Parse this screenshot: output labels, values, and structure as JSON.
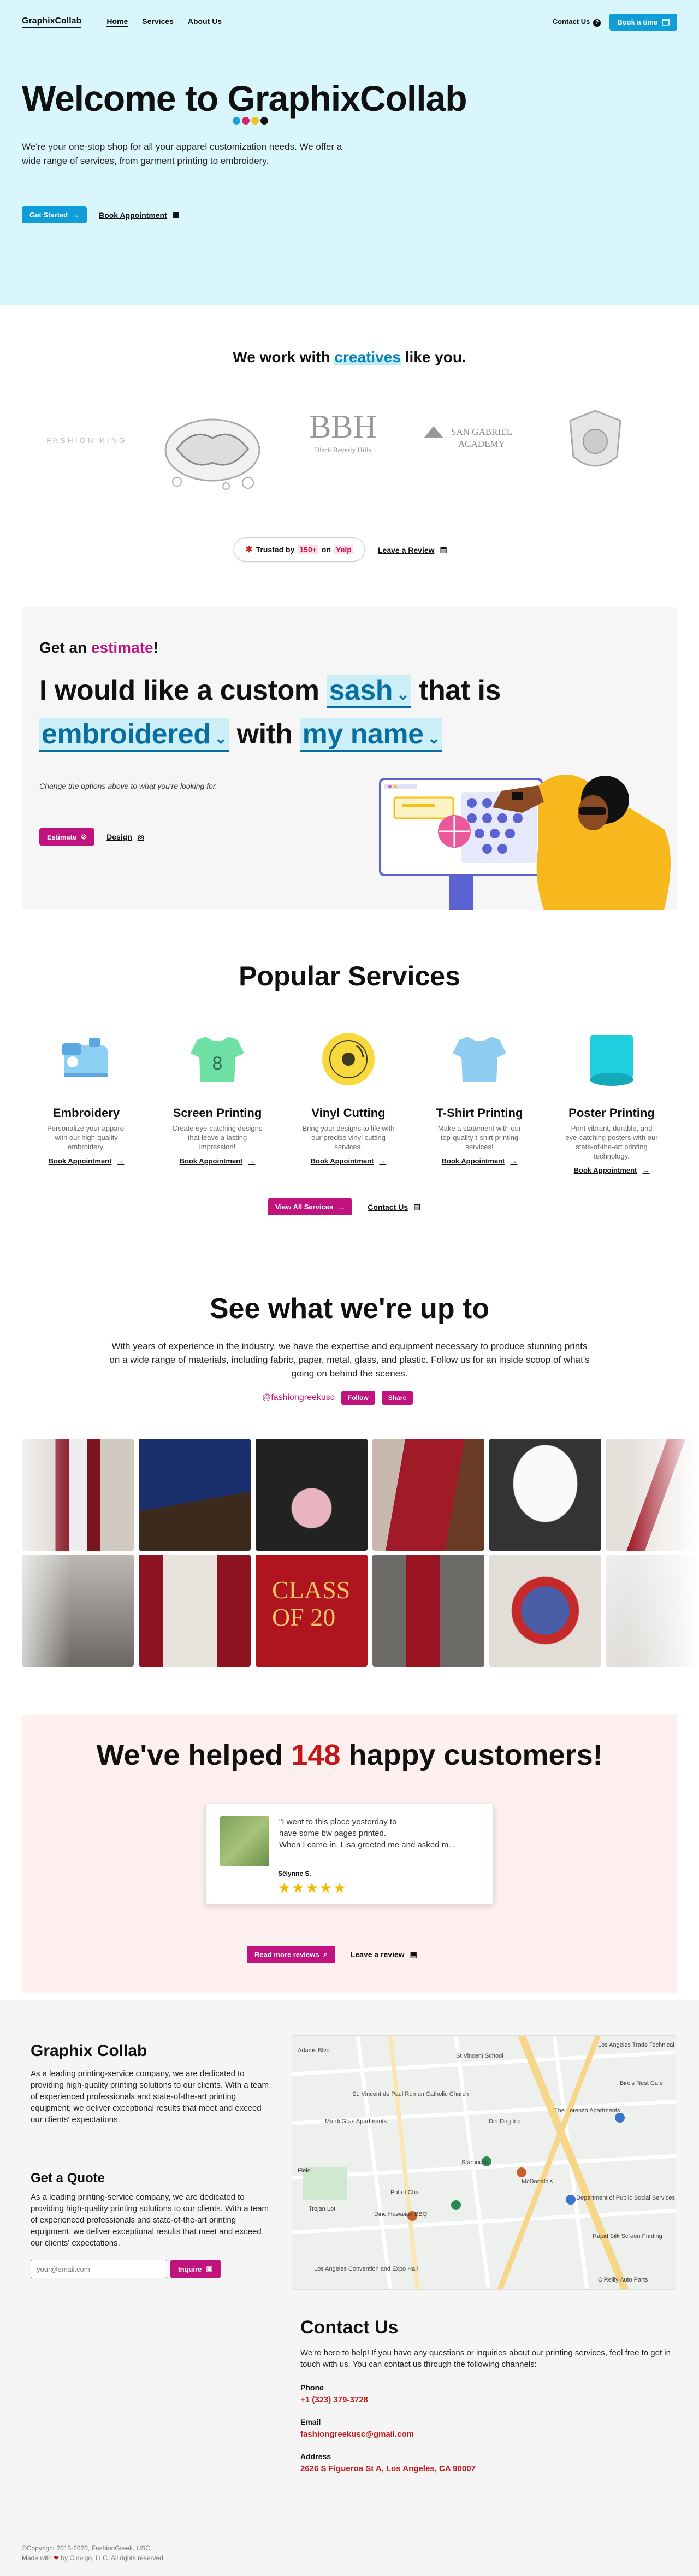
{
  "nav": {
    "logo": "GraphixCollab",
    "links": [
      "Home",
      "Services",
      "About Us"
    ],
    "contact": "Contact Us",
    "book": "Book a time"
  },
  "hero": {
    "title_prefix": "Welcome to ",
    "title_brand": "GraphixCollab",
    "lead": "We're your one-stop shop for all your apparel customization needs. We offer a wide range of services, from garment printing to embroidery.",
    "get_started": "Get Started",
    "book_appointment": "Book Appointment",
    "dot_colors": [
      "#1aa3d9",
      "#d6246e",
      "#f3c21b",
      "#111111"
    ]
  },
  "clients": {
    "title_pre": "We work with ",
    "title_hl": "creatives",
    "title_post": " like you.",
    "logos": [
      "FASHION KING",
      "Black Beverly Hills",
      "SAN GABRIEL ACADEMY"
    ],
    "trusted_pre": "Trusted by ",
    "trusted_num": "150+",
    "trusted_mid": " on ",
    "trusted_brand": "Yelp",
    "leave_review": "Leave a Review"
  },
  "estimate": {
    "get_an": "Get an ",
    "estimate_word": "estimate",
    "excl": "!",
    "s1": "I would like a custom ",
    "opt_item": "sash",
    "s2": " that is",
    "opt_method": "embroidered",
    "s3": " with ",
    "opt_content": "my name",
    "hint": "Change the options above to what you're looking for.",
    "btn_estimate": "Estimate",
    "btn_design": "Design"
  },
  "services": {
    "title": "Popular Services",
    "items": [
      {
        "name": "Embroidery",
        "desc": "Personalize your apparel with our high-quality embroidery.",
        "book": "Book Appointment"
      },
      {
        "name": "Screen Printing",
        "desc": "Create eye-catching designs that leave a lasting impression!",
        "book": "Book Appointment"
      },
      {
        "name": "Vinyl Cutting",
        "desc": "Bring your designs to life with our precise vinyl cutting services.",
        "book": "Book Appointment"
      },
      {
        "name": "T-Shirt Printing",
        "desc": "Make a statement with our top-quality t-shirt printing services!",
        "book": "Book Appointment"
      },
      {
        "name": "Poster Printing",
        "desc": "Print vibrant, durable, and eye-catching posters with our state-of-the-art printing technology.",
        "book": "Book Appointment"
      }
    ],
    "view_all": "View All Services",
    "contact": "Contact Us"
  },
  "upto": {
    "title": "See what we're up to",
    "desc": "With years of experience in the industry, we have the expertise and equipment necessary to produce stunning prints on a wide range of materials, including fabric, paper, metal, glass, and plastic. Follow us for an inside scoop of what's going on behind the scenes.",
    "handle": "@fashiongreekusc",
    "follow": "Follow",
    "share": "Share",
    "tile_text": "CLASS OF 20"
  },
  "reviews": {
    "pre": "We've helped ",
    "count": "148",
    "post": " happy customers!",
    "quote_l1": "\"I went to this place yesterday to have some bw pages printed.",
    "quote_l2": "When I came in, Lisa greeted me and asked m...",
    "author": "Sélynne S.",
    "stars": "★★★★★",
    "read_more": "Read more reviews",
    "leave": "Leave a review"
  },
  "footer": {
    "brand": "Graphix Collab",
    "about": "As a leading printing-service company, we are dedicated to providing high-quality printing solutions to our clients. With a team of experienced professionals and state-of-the-art printing equipment, we deliver exceptional results that meet and exceed our clients' expectations.",
    "quote_title": "Get a Quote",
    "quote_text": "As a leading printing-service company, we are dedicated to providing high-quality printing solutions to our clients. With a team of experienced professionals and state-of-the-art printing equipment, we deliver exceptional results that meet and exceed our clients' expectations.",
    "email_placeholder": "your@email.com",
    "inquire": "Inquire",
    "map_labels": [
      "St Vincent School",
      "Los Angeles Trade Technical College",
      "St. Vincent de Paul Roman Catholic Church",
      "Mardi Gras Apartments",
      "Dirt Dog Inc",
      "The Lorenzo Apartments",
      "Starbucks",
      "McDonald's",
      "Pot of Cha",
      "Dino Hawaiian BBQ",
      "Department of Public Social Services",
      "Rapid Silk Screen Printing",
      "O'Reilly Auto Parts",
      "Field",
      "Trojan Lot",
      "Bird's Nest Cafe",
      "Adams Blvd",
      "Los Angeles Convention and Expo Hall"
    ],
    "contact_title": "Contact Us",
    "contact_text": "We're here to help! If you have any questions or inquiries about our printing services, feel free to get in touch with us. You can contact us through the following channels:",
    "phone_label": "Phone",
    "phone": "+1 (323) 379-3728",
    "email_label": "Email",
    "email": "fashiongreekusc@gmail.com",
    "address_label": "Address",
    "address": "2626 S Figueroa St A, Los Angeles, CA 90007",
    "copy1": "©Copyright 2015-2020, FashionGreek, USC.",
    "copy2_pre": "Made with ",
    "heart": "❤",
    "copy2_post": " by Cinelgo, LLC. All rights reserved."
  }
}
